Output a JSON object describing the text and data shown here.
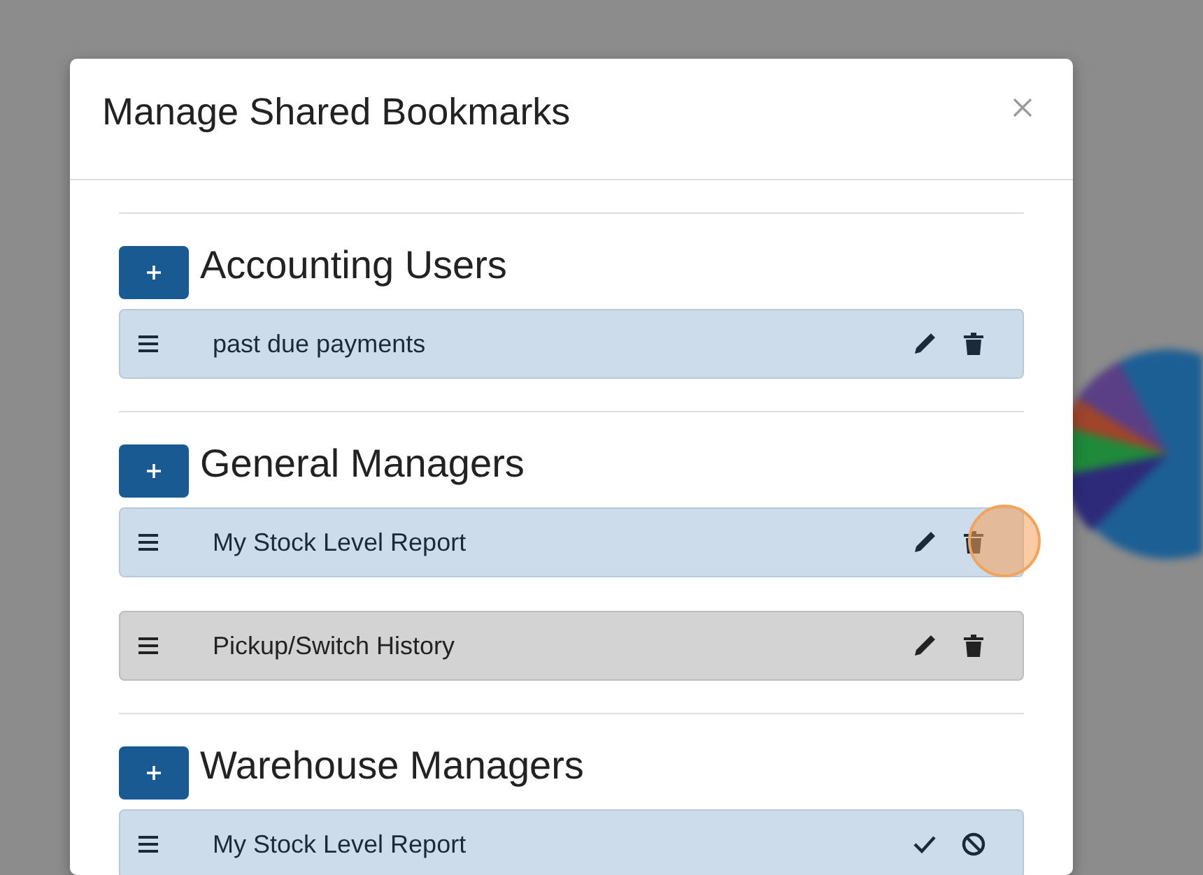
{
  "dialog": {
    "title": "Manage Shared Bookmarks",
    "groups": [
      {
        "name": "Accounting Users",
        "bookmarks": [
          {
            "label": "past due payments",
            "highlighted": true,
            "kind": "view",
            "clicked": false
          }
        ]
      },
      {
        "name": "General Managers",
        "bookmarks": [
          {
            "label": "My Stock Level Report",
            "highlighted": true,
            "kind": "view",
            "clicked": true
          },
          {
            "label": "Pickup/Switch History",
            "highlighted": false,
            "kind": "view",
            "clicked": false
          }
        ]
      },
      {
        "name": "Warehouse Managers",
        "bookmarks": [
          {
            "label": "My Stock Level Report",
            "highlighted": true,
            "kind": "edit",
            "clicked": false
          }
        ]
      }
    ]
  }
}
